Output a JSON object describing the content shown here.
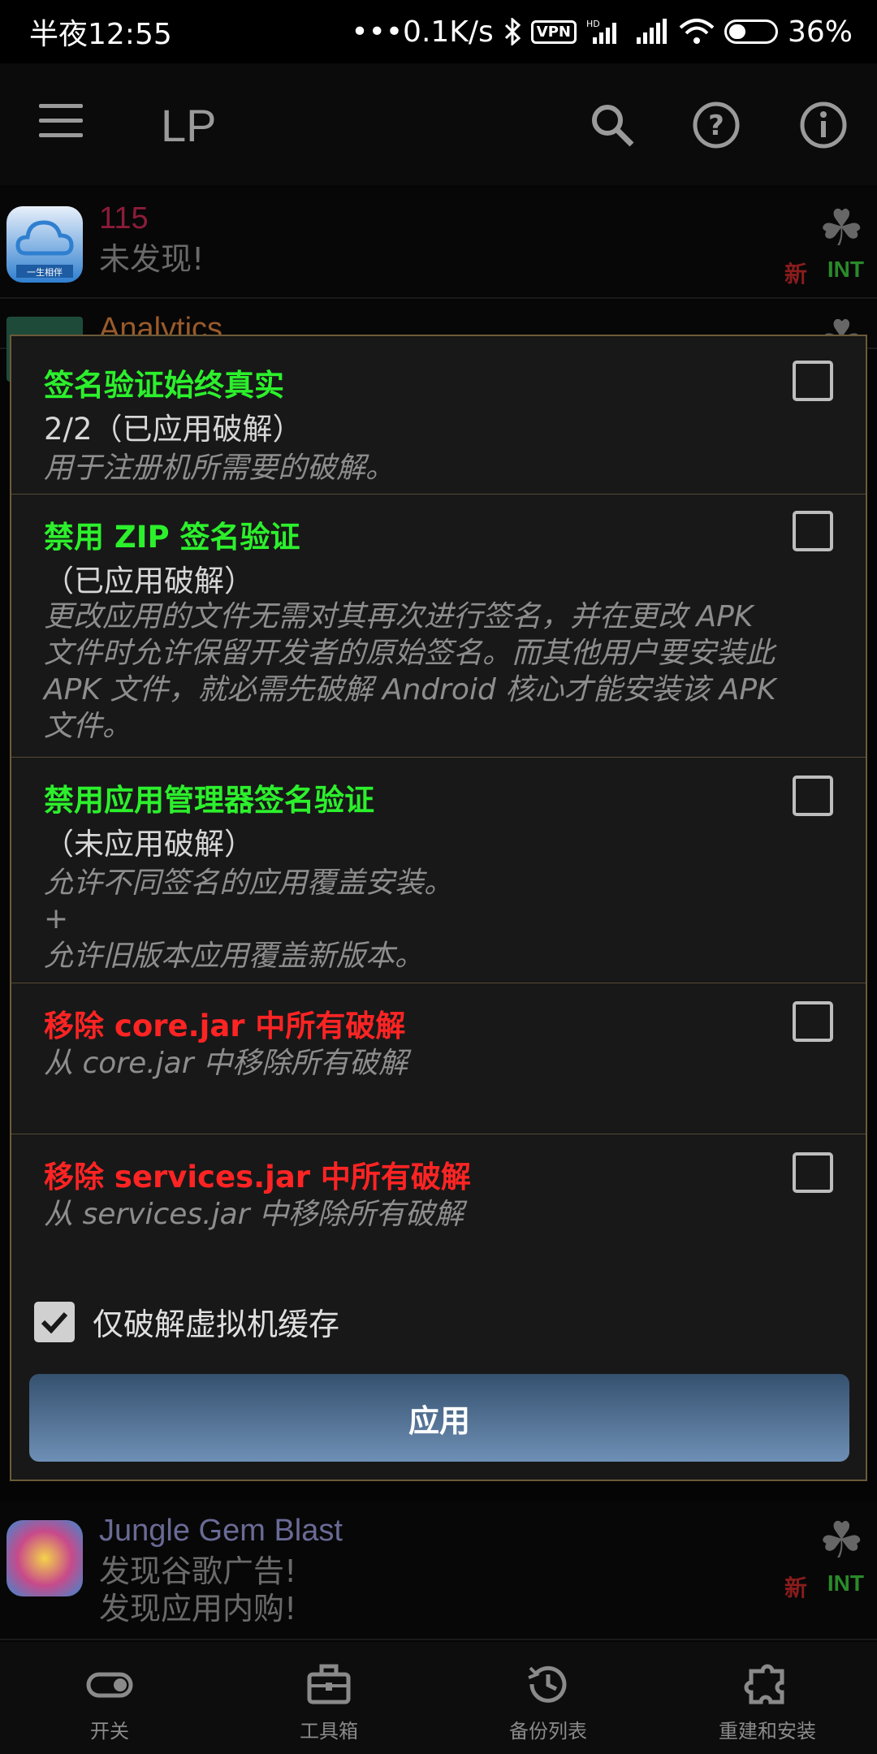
{
  "status": {
    "time": "半夜12:55",
    "network": "0.1K/s",
    "vpn": "VPN",
    "battery": "36%"
  },
  "appbar": {
    "title": "LP"
  },
  "list": [
    {
      "name": "115",
      "name_color": "#8b1c3a",
      "sub1": "未发现!",
      "badge_new": "新",
      "badge_int": "INT",
      "icon_text": "一生相伴"
    },
    {
      "name": "Analytics",
      "name_color": "#9a5a2a"
    },
    {
      "name": "Jungle Gem Blast",
      "name_color": "#6a6a96",
      "sub1": "发现谷歌广告!",
      "sub2": "发现应用内购!",
      "badge_new": "新",
      "badge_int": "INT"
    }
  ],
  "dialog": {
    "items": [
      {
        "title": "签名验证始终真实",
        "color": "green",
        "status": "2/2（已应用破解）",
        "desc": "用于注册机所需要的破解。"
      },
      {
        "title": "禁用 ZIP 签名验证",
        "color": "green",
        "status": "（已应用破解）",
        "desc": "更改应用的文件无需对其再次进行签名，并在更改 APK 文件时允许保留开发者的原始签名。而其他用户要安装此 APK 文件，就必需先破解 Android 核心才能安装该 APK 文件。"
      },
      {
        "title": "禁用应用管理器签名验证",
        "color": "green",
        "status": "（未应用破解）",
        "desc1": "允许不同签名的应用覆盖安装。",
        "desc2": "+",
        "desc3": "允许旧版本应用覆盖新版本。"
      },
      {
        "title": "移除 core.jar 中所有破解",
        "color": "red",
        "desc": "从 core.jar 中移除所有破解"
      },
      {
        "title": "移除 services.jar 中所有破解",
        "color": "red",
        "desc": "从 services.jar 中移除所有破解"
      }
    ],
    "vm_only_label": "仅破解虚拟机缓存",
    "vm_only_checked": true,
    "apply_label": "应用"
  },
  "bottom_nav": [
    {
      "label": "开关",
      "icon": "toggle-icon"
    },
    {
      "label": "工具箱",
      "icon": "toolbox-icon"
    },
    {
      "label": "备份列表",
      "icon": "backup-icon"
    },
    {
      "label": "重建和安装",
      "icon": "puzzle-icon"
    }
  ]
}
